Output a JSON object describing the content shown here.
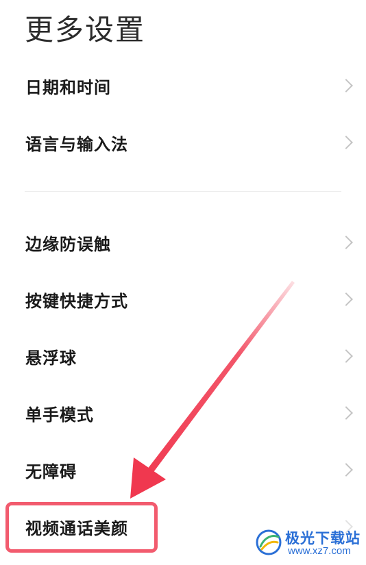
{
  "header": {
    "title": "更多设置"
  },
  "settings": {
    "items": [
      {
        "label": "日期和时间"
      },
      {
        "label": "语言与输入法"
      },
      {
        "label": "边缘防误触"
      },
      {
        "label": "按键快捷方式"
      },
      {
        "label": "悬浮球"
      },
      {
        "label": "单手模式"
      },
      {
        "label": "无障碍"
      },
      {
        "label": "视频通话美颜"
      }
    ]
  },
  "annotation": {
    "highlight_color": "#f25b6e",
    "arrow_color": "#f0384f"
  },
  "watermark": {
    "name": "极光下载站",
    "site": "www.xz7.com",
    "icon": "aurora-logo-icon"
  },
  "colors": {
    "background": "#ffffff",
    "text": "#1a1a1a",
    "chevron": "#c4c4c4",
    "divider": "#ececec"
  }
}
